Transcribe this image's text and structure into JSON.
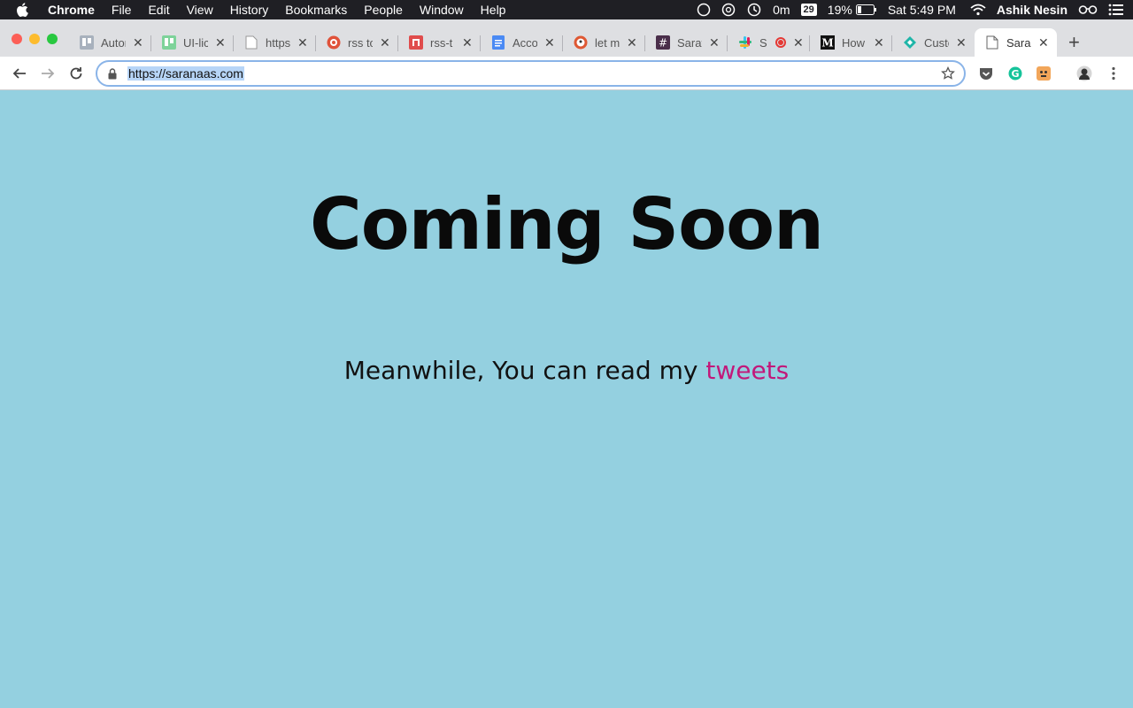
{
  "menubar": {
    "app_name": "Chrome",
    "items": [
      "File",
      "Edit",
      "View",
      "History",
      "Bookmarks",
      "People",
      "Window",
      "Help"
    ],
    "timer": "0m",
    "calendar_day": "29",
    "battery": "19%",
    "clock": "Sat 5:49 PM",
    "user": "Ashik Nesin"
  },
  "tabs": [
    {
      "title": "Autor",
      "icon": "trello-icon"
    },
    {
      "title": "UI-lic",
      "icon": "trello-green-icon"
    },
    {
      "title": "https",
      "icon": "document-icon"
    },
    {
      "title": "rss to",
      "icon": "rss-icon"
    },
    {
      "title": "rss-t",
      "icon": "repo-icon"
    },
    {
      "title": "Acco",
      "icon": "google-docs-icon"
    },
    {
      "title": "let m",
      "icon": "duckduckgo-icon"
    },
    {
      "title": "Sarav",
      "icon": "hashtag-icon"
    },
    {
      "title": "S",
      "icon": "slack-icon"
    },
    {
      "title": "How",
      "icon": "medium-icon"
    },
    {
      "title": "Custo",
      "icon": "diamond-icon"
    },
    {
      "title": "Sara",
      "icon": "document-icon",
      "active": true
    }
  ],
  "omnibox": {
    "url": "https://saranaas.com"
  },
  "page": {
    "headline": "Coming Soon",
    "subline_prefix": "Meanwhile, You can read my ",
    "subline_link": "tweets"
  },
  "colors": {
    "page_bg": "#94d0e0",
    "link": "#c2187a",
    "menubar_bg": "#1f1f24",
    "tabstrip_bg": "#dedfe2"
  }
}
